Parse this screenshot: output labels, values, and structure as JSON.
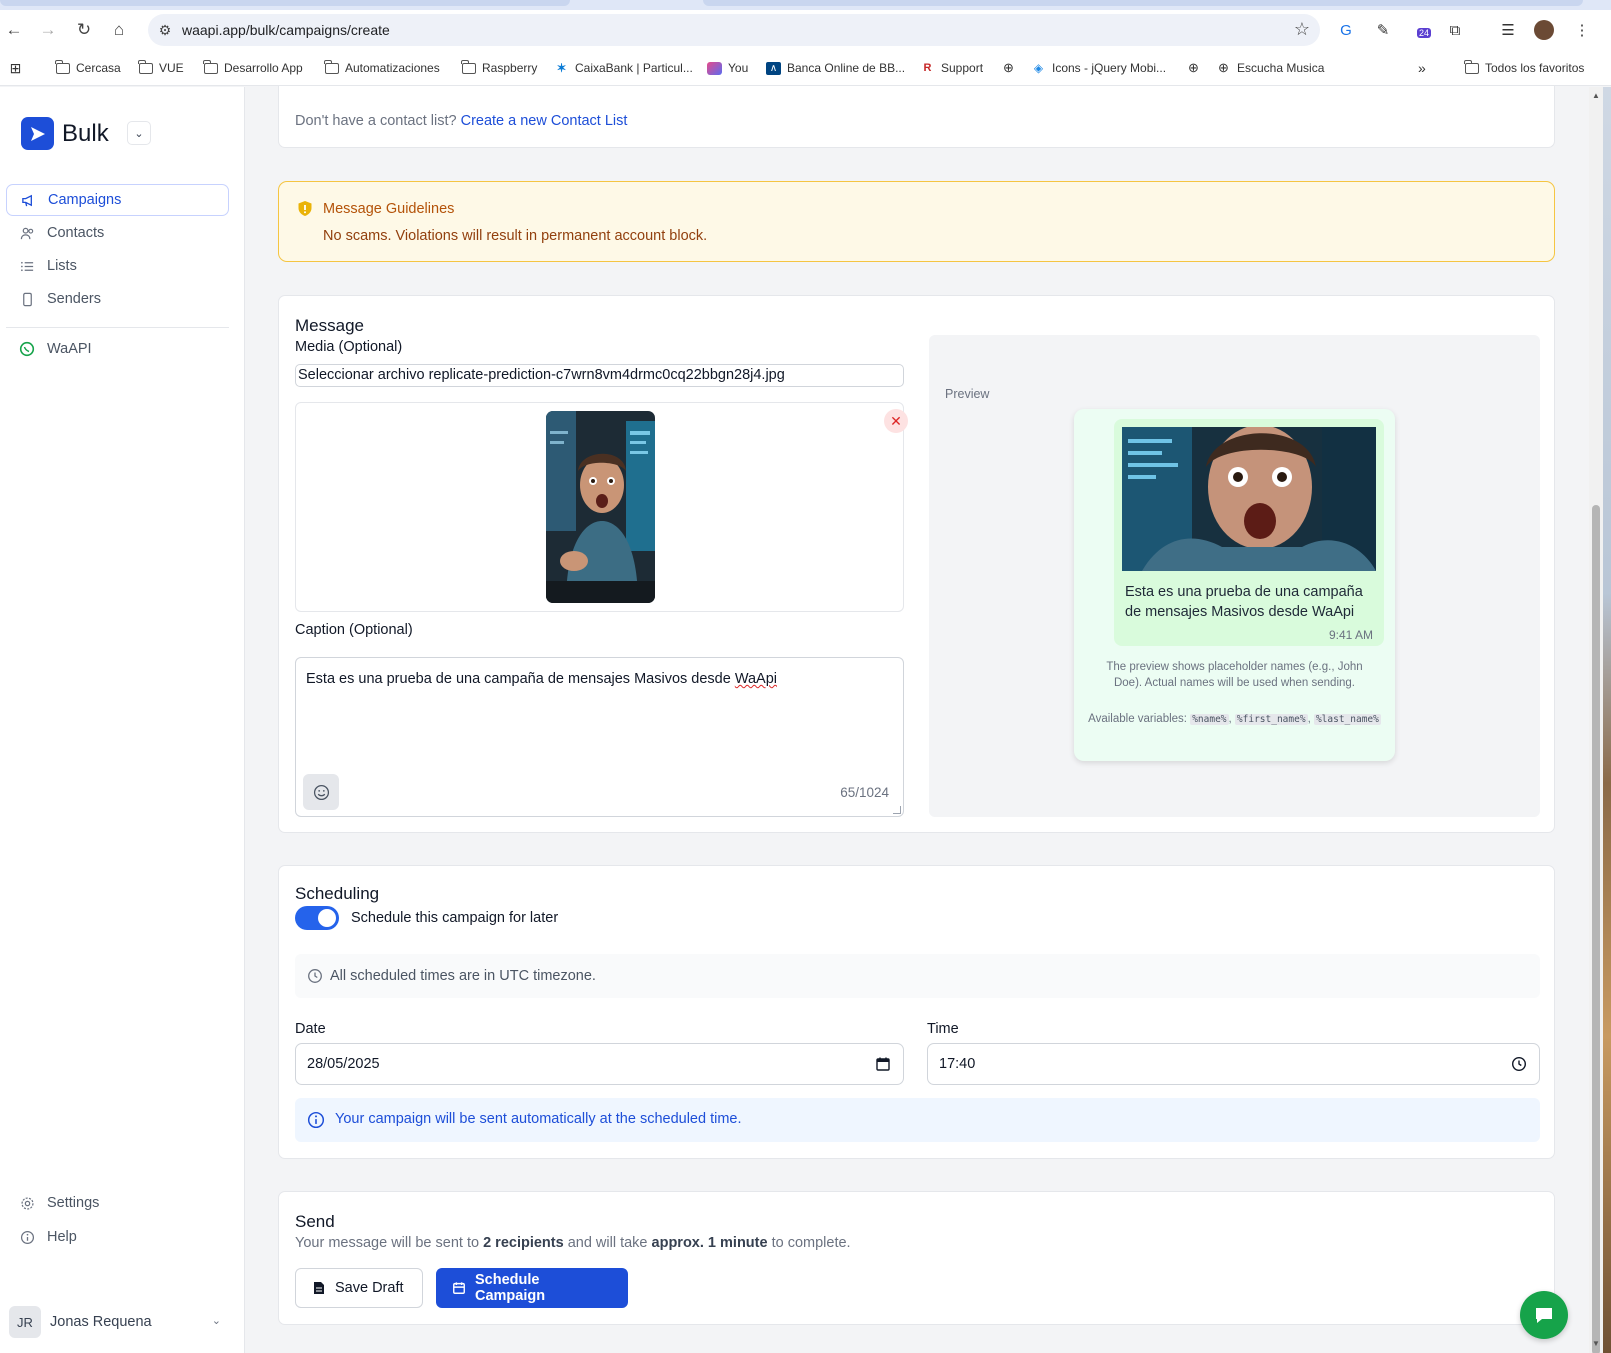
{
  "browser": {
    "url": "waapi.app/bulk/campaigns/create",
    "bookmarks": [
      "Cercasa",
      "VUE",
      "Desarrollo App",
      "Automatizaciones",
      "Raspberry",
      "CaixaBank | Particul...",
      "You",
      "Banca Online de BB...",
      "Support",
      "Icons - jQuery Mobi...",
      "Escucha Musica"
    ],
    "all_bookmarks": "Todos los favoritos",
    "extension_badge": "24"
  },
  "sidebar": {
    "brand": "Bulk",
    "items": [
      {
        "label": "Campaigns",
        "icon": "megaphone-icon"
      },
      {
        "label": "Contacts",
        "icon": "users-icon"
      },
      {
        "label": "Lists",
        "icon": "list-icon"
      },
      {
        "label": "Senders",
        "icon": "phone-icon"
      }
    ],
    "secondary": [
      {
        "label": "WaAPI",
        "icon": "whatsapp-icon"
      }
    ],
    "bottom": [
      {
        "label": "Settings",
        "icon": "gear-icon"
      },
      {
        "label": "Help",
        "icon": "help-icon"
      }
    ],
    "user": {
      "initials": "JR",
      "name": "Jonas Requena"
    }
  },
  "contacts": {
    "prefix": "Don't have a contact list?",
    "link": "Create a new Contact List"
  },
  "guidelines": {
    "title": "Message Guidelines",
    "text": "No scams. Violations will result in permanent account block."
  },
  "message": {
    "title": "Message",
    "media_label": "Media (Optional)",
    "file_input": "Seleccionar archivo replicate-prediction-c7wrn8vm4drmc0cq22bbgn28j4.jpg",
    "caption_label": "Caption (Optional)",
    "caption_main": "Esta es una prueba de una campaña de mensajes Masivos desde ",
    "caption_misspelled": "WaApi",
    "char_count": "65/1024"
  },
  "preview": {
    "label": "Preview",
    "bubble_text": "Esta es una prueba de una campaña de mensajes Masivos desde WaApi",
    "time": "9:41 AM",
    "note": "The preview shows placeholder names (e.g., John Doe). Actual names will be used when sending.",
    "vars_label": "Available variables:",
    "vars": [
      "%name%",
      "%first_name%",
      "%last_name%"
    ]
  },
  "scheduling": {
    "title": "Scheduling",
    "toggle_label": "Schedule this campaign for later",
    "toggle_on": true,
    "tz_note": "All scheduled times are in UTC timezone.",
    "date_label": "Date",
    "date_value": "28/05/2025",
    "time_label": "Time",
    "time_value": "17:40",
    "info_note": "Your campaign will be sent automatically at the scheduled time."
  },
  "send": {
    "title": "Send",
    "text_1": "Your message will be sent to ",
    "recipients": "2 recipients",
    "text_2": " and will take ",
    "duration": "approx. 1 minute",
    "text_3": " to complete.",
    "save_draft": "Save Draft",
    "schedule_campaign": "Schedule Campaign"
  },
  "colors": {
    "primary": "#1d4ed8",
    "warning_bg": "#fef9e7",
    "warning_border": "#f5c542",
    "chat_green": "#16a34a"
  }
}
